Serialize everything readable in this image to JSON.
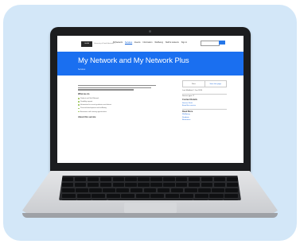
{
  "site": {
    "logo_text": "UniSA",
    "logo_caption": "University of South Australia",
    "nav": [
      "MyNetwork",
      "Services",
      "Events",
      "Information",
      "Wellbeing",
      "Staff & students",
      "Sign in"
    ],
    "search_placeholder": "Search"
  },
  "banner": {
    "title": "My Network and My Network Plus",
    "subtitle": "Services"
  },
  "main": {
    "section_heading": "What we do",
    "bullets": [
      "Student and Staff Network",
      "Disability support",
      "Information for recent graduates and alumni",
      "Personal development and wellbeing",
      "Assistance with training opportunities"
    ],
    "section_heading_2": "About this service"
  },
  "sidebar": {
    "tabs": [
      "Print",
      "Save this page"
    ],
    "last_updated": "Last Modified: 1 Jan 2020",
    "service_type": "Service type: IT",
    "contact_heading": "Contact Details",
    "contact_link": "Service Desk",
    "contact_email_link": "Email this service",
    "related_heading": "Read More",
    "related_links": [
      "Wellbeing",
      "Students",
      "Resources"
    ]
  },
  "colors": {
    "card": "#d3e7f8",
    "banner": "#1a6ff0",
    "laptop_bezel": "#1c1d1f",
    "laptop_body": "#d8dadd"
  }
}
